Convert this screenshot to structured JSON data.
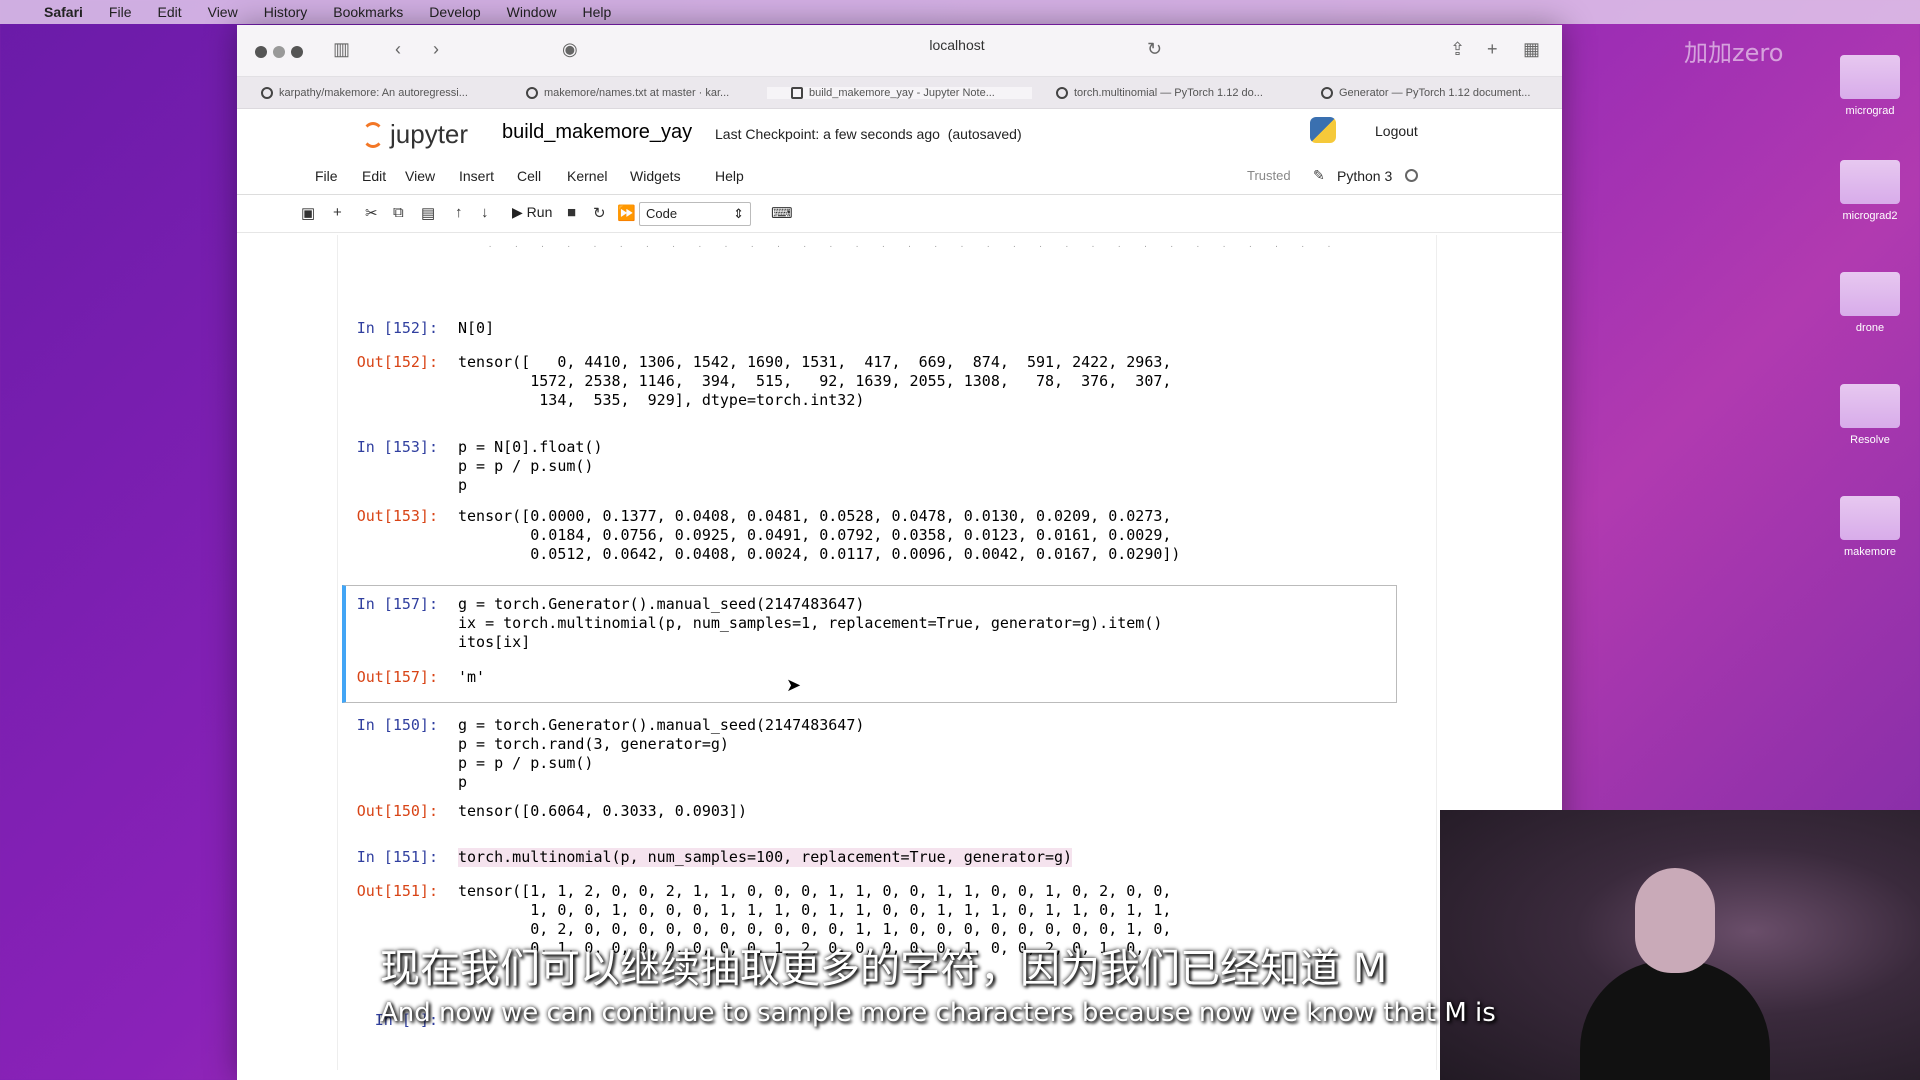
{
  "menubar": {
    "app": "Safari",
    "items": [
      "File",
      "Edit",
      "View",
      "History",
      "Bookmarks",
      "Develop",
      "Window",
      "Help"
    ]
  },
  "browser": {
    "url": "localhost",
    "tabs": [
      "karpathy/makemore: An autoregressi...",
      "makemore/names.txt at master · kar...",
      "build_makemore_yay - Jupyter Note...",
      "torch.multinomial — PyTorch 1.12 do...",
      "Generator — PyTorch 1.12 document..."
    ]
  },
  "jupyter": {
    "logo": "jupyter",
    "title": "build_makemore_yay",
    "checkpoint": "Last Checkpoint: a few seconds ago",
    "autosaved": "(autosaved)",
    "logout": "Logout",
    "menu": [
      "File",
      "Edit",
      "View",
      "Insert",
      "Cell",
      "Kernel",
      "Widgets",
      "Help"
    ],
    "trusted": "Trusted",
    "kernel": "Python 3",
    "run": "Run",
    "cell_type": "Code"
  },
  "cells": [
    {
      "in": "In [152]:",
      "code": "N[0]",
      "out": "Out[152]:",
      "output": "tensor([   0, 4410, 1306, 1542, 1690, 1531,  417,  669,  874,  591, 2422, 2963,\n        1572, 2538, 1146,  394,  515,   92, 1639, 2055, 1308,   78,  376,  307,\n         134,  535,  929], dtype=torch.int32)"
    },
    {
      "in": "In [153]:",
      "code": "p = N[0].float()\np = p / p.sum()\np",
      "out": "Out[153]:",
      "output": "tensor([0.0000, 0.1377, 0.0408, 0.0481, 0.0528, 0.0478, 0.0130, 0.0209, 0.0273,\n        0.0184, 0.0756, 0.0925, 0.0491, 0.0792, 0.0358, 0.0123, 0.0161, 0.0029,\n        0.0512, 0.0642, 0.0408, 0.0024, 0.0117, 0.0096, 0.0042, 0.0167, 0.0290])"
    },
    {
      "in": "In [157]:",
      "code": "g = torch.Generator().manual_seed(2147483647)\nix = torch.multinomial(p, num_samples=1, replacement=True, generator=g).item()\nitos[ix]",
      "out": "Out[157]:",
      "output": "'m'"
    },
    {
      "in": "In [150]:",
      "code": "g = torch.Generator().manual_seed(2147483647)\np = torch.rand(3, generator=g)\np = p / p.sum()\np",
      "out": "Out[150]:",
      "output": "tensor([0.6064, 0.3033, 0.0903])"
    },
    {
      "in": "In [151]:",
      "code": "torch.multinomial(p, num_samples=100, replacement=True, generator=g)",
      "out": "Out[151]:",
      "output": "tensor([1, 1, 2, 0, 0, 2, 1, 1, 0, 0, 0, 1, 1, 0, 0, 1, 1, 0, 0, 1, 0, 2, 0, 0,\n        1, 0, 0, 1, 0, 0, 0, 1, 1, 1, 0, 1, 1, 0, 0, 1, 1, 1, 0, 1, 1, 0, 1, 1,\n        0, 2, 0, 0, 0, 0, 0, 0, 0, 0, 0, 0, 1, 1, 0, 0, 0, 0, 0, 0, 0, 0, 1, 0,\n        0, 1, 0, 0, 0, 0, 0, 0, 0, 1, 2, 0, 0, 0, 0, 0, 1, 0, 0, 2, 0, 1, 0,"
    },
    {
      "in": "In [ ]:"
    }
  ],
  "desktop": [
    "micrograd",
    "micrograd2",
    "drone",
    "Resolve",
    "makemore"
  ],
  "watermark": "加加zero",
  "subtitles": {
    "cn": "现在我们可以继续抽取更多的字符，因为我们已经知道 M",
    "en": "And now we can continue to sample more characters because now we know that M is"
  }
}
